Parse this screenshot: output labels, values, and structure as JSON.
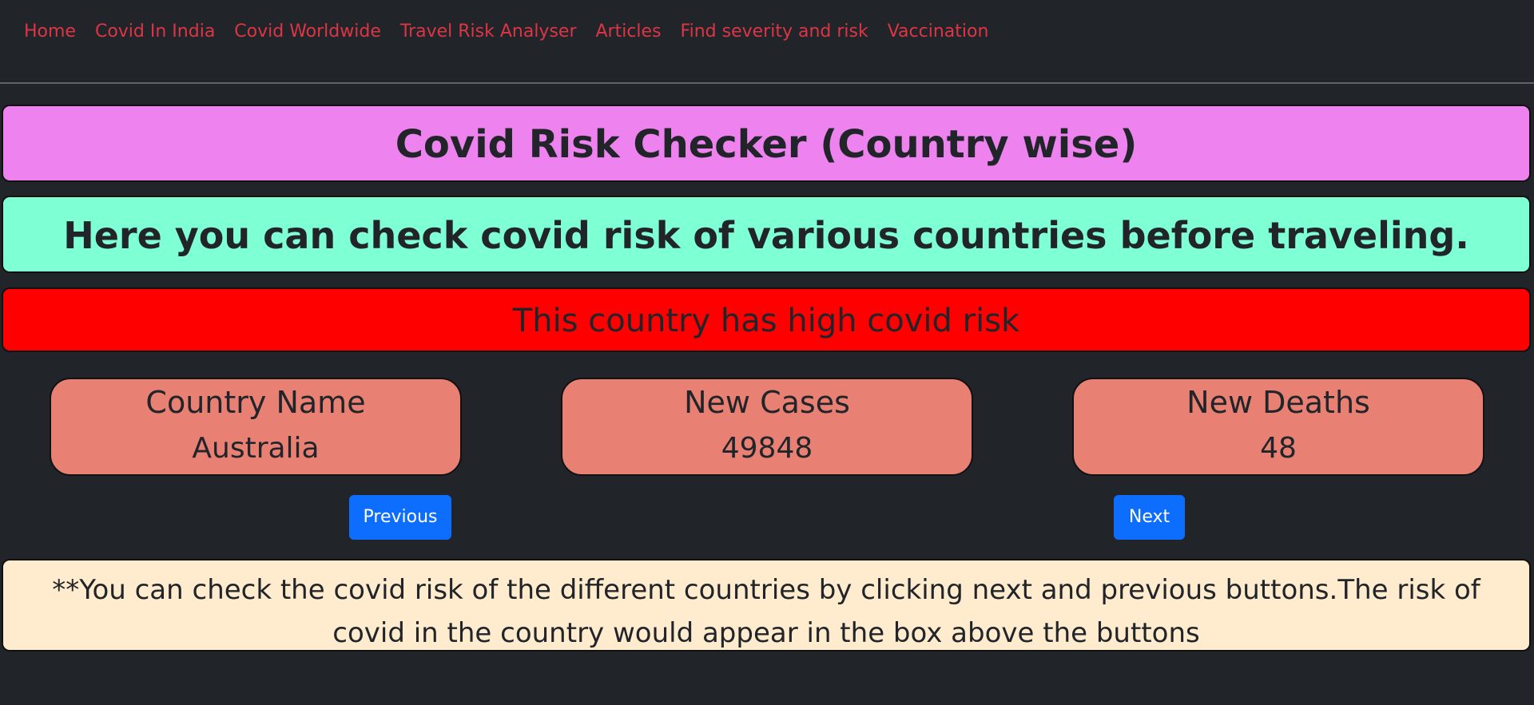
{
  "nav": {
    "items": [
      {
        "label": "Home"
      },
      {
        "label": "Covid In India"
      },
      {
        "label": "Covid Worldwide"
      },
      {
        "label": "Travel Risk Analyser"
      },
      {
        "label": "Articles"
      },
      {
        "label": "Find severity and risk"
      },
      {
        "label": "Vaccination"
      }
    ]
  },
  "header": {
    "title": "Covid Risk Checker (Country wise)",
    "subtitle": "Here you can check covid risk of various countries before traveling."
  },
  "risk": {
    "message": "This country has high covid risk",
    "color": "#ff0000"
  },
  "cards": [
    {
      "title": "Country Name",
      "value": "Australia"
    },
    {
      "title": "New Cases",
      "value": "49848"
    },
    {
      "title": "New Deaths",
      "value": "48"
    }
  ],
  "controls": {
    "previous_label": "Previous",
    "next_label": "Next"
  },
  "note": {
    "text": "**You can check the covid risk of the different countries by clicking next and previous buttons.The risk of covid in the country would appear in the box above the buttons"
  },
  "colors": {
    "background": "#212529",
    "nav_link": "#dc3545",
    "title_bg": "#ee82ee",
    "subtitle_bg": "#7fffd4",
    "card_bg": "#e88174",
    "button_bg": "#0d6efd",
    "note_bg": "#ffebcd"
  }
}
